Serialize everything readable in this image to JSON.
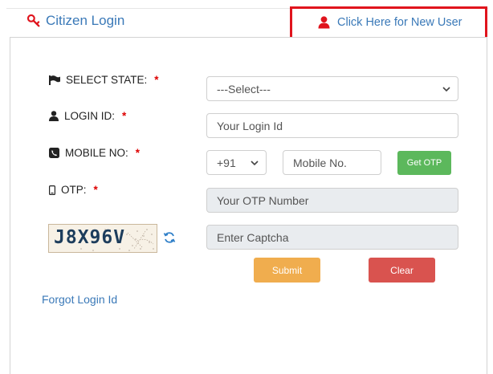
{
  "header": {
    "title": "Citizen Login",
    "icon": "key-icon"
  },
  "new_user": {
    "label": "Click Here for New User",
    "icon": "user-icon",
    "highlight_color": "#e0141d"
  },
  "form": {
    "state": {
      "label": "SELECT STATE:",
      "required": "*",
      "selected": "---Select---"
    },
    "login_id": {
      "label": "LOGIN ID:",
      "required": "*",
      "placeholder": "Your Login Id"
    },
    "mobile": {
      "label": "MOBILE NO:",
      "required": "*",
      "country_code": "+91",
      "placeholder": "Mobile No.",
      "otp_button": "Get OTP"
    },
    "otp": {
      "label": "OTP:",
      "required": "*",
      "placeholder": "Your OTP Number"
    },
    "captcha": {
      "code": "J8X96V",
      "placeholder": "Enter Captcha"
    },
    "submit_label": "Submit",
    "clear_label": "Clear"
  },
  "forgot_link": "Forgot Login Id",
  "colors": {
    "link": "#3a79b8",
    "submit": "#f0ad4e",
    "clear": "#d9534f",
    "otp": "#5cb85c",
    "required": "#dd0000"
  }
}
